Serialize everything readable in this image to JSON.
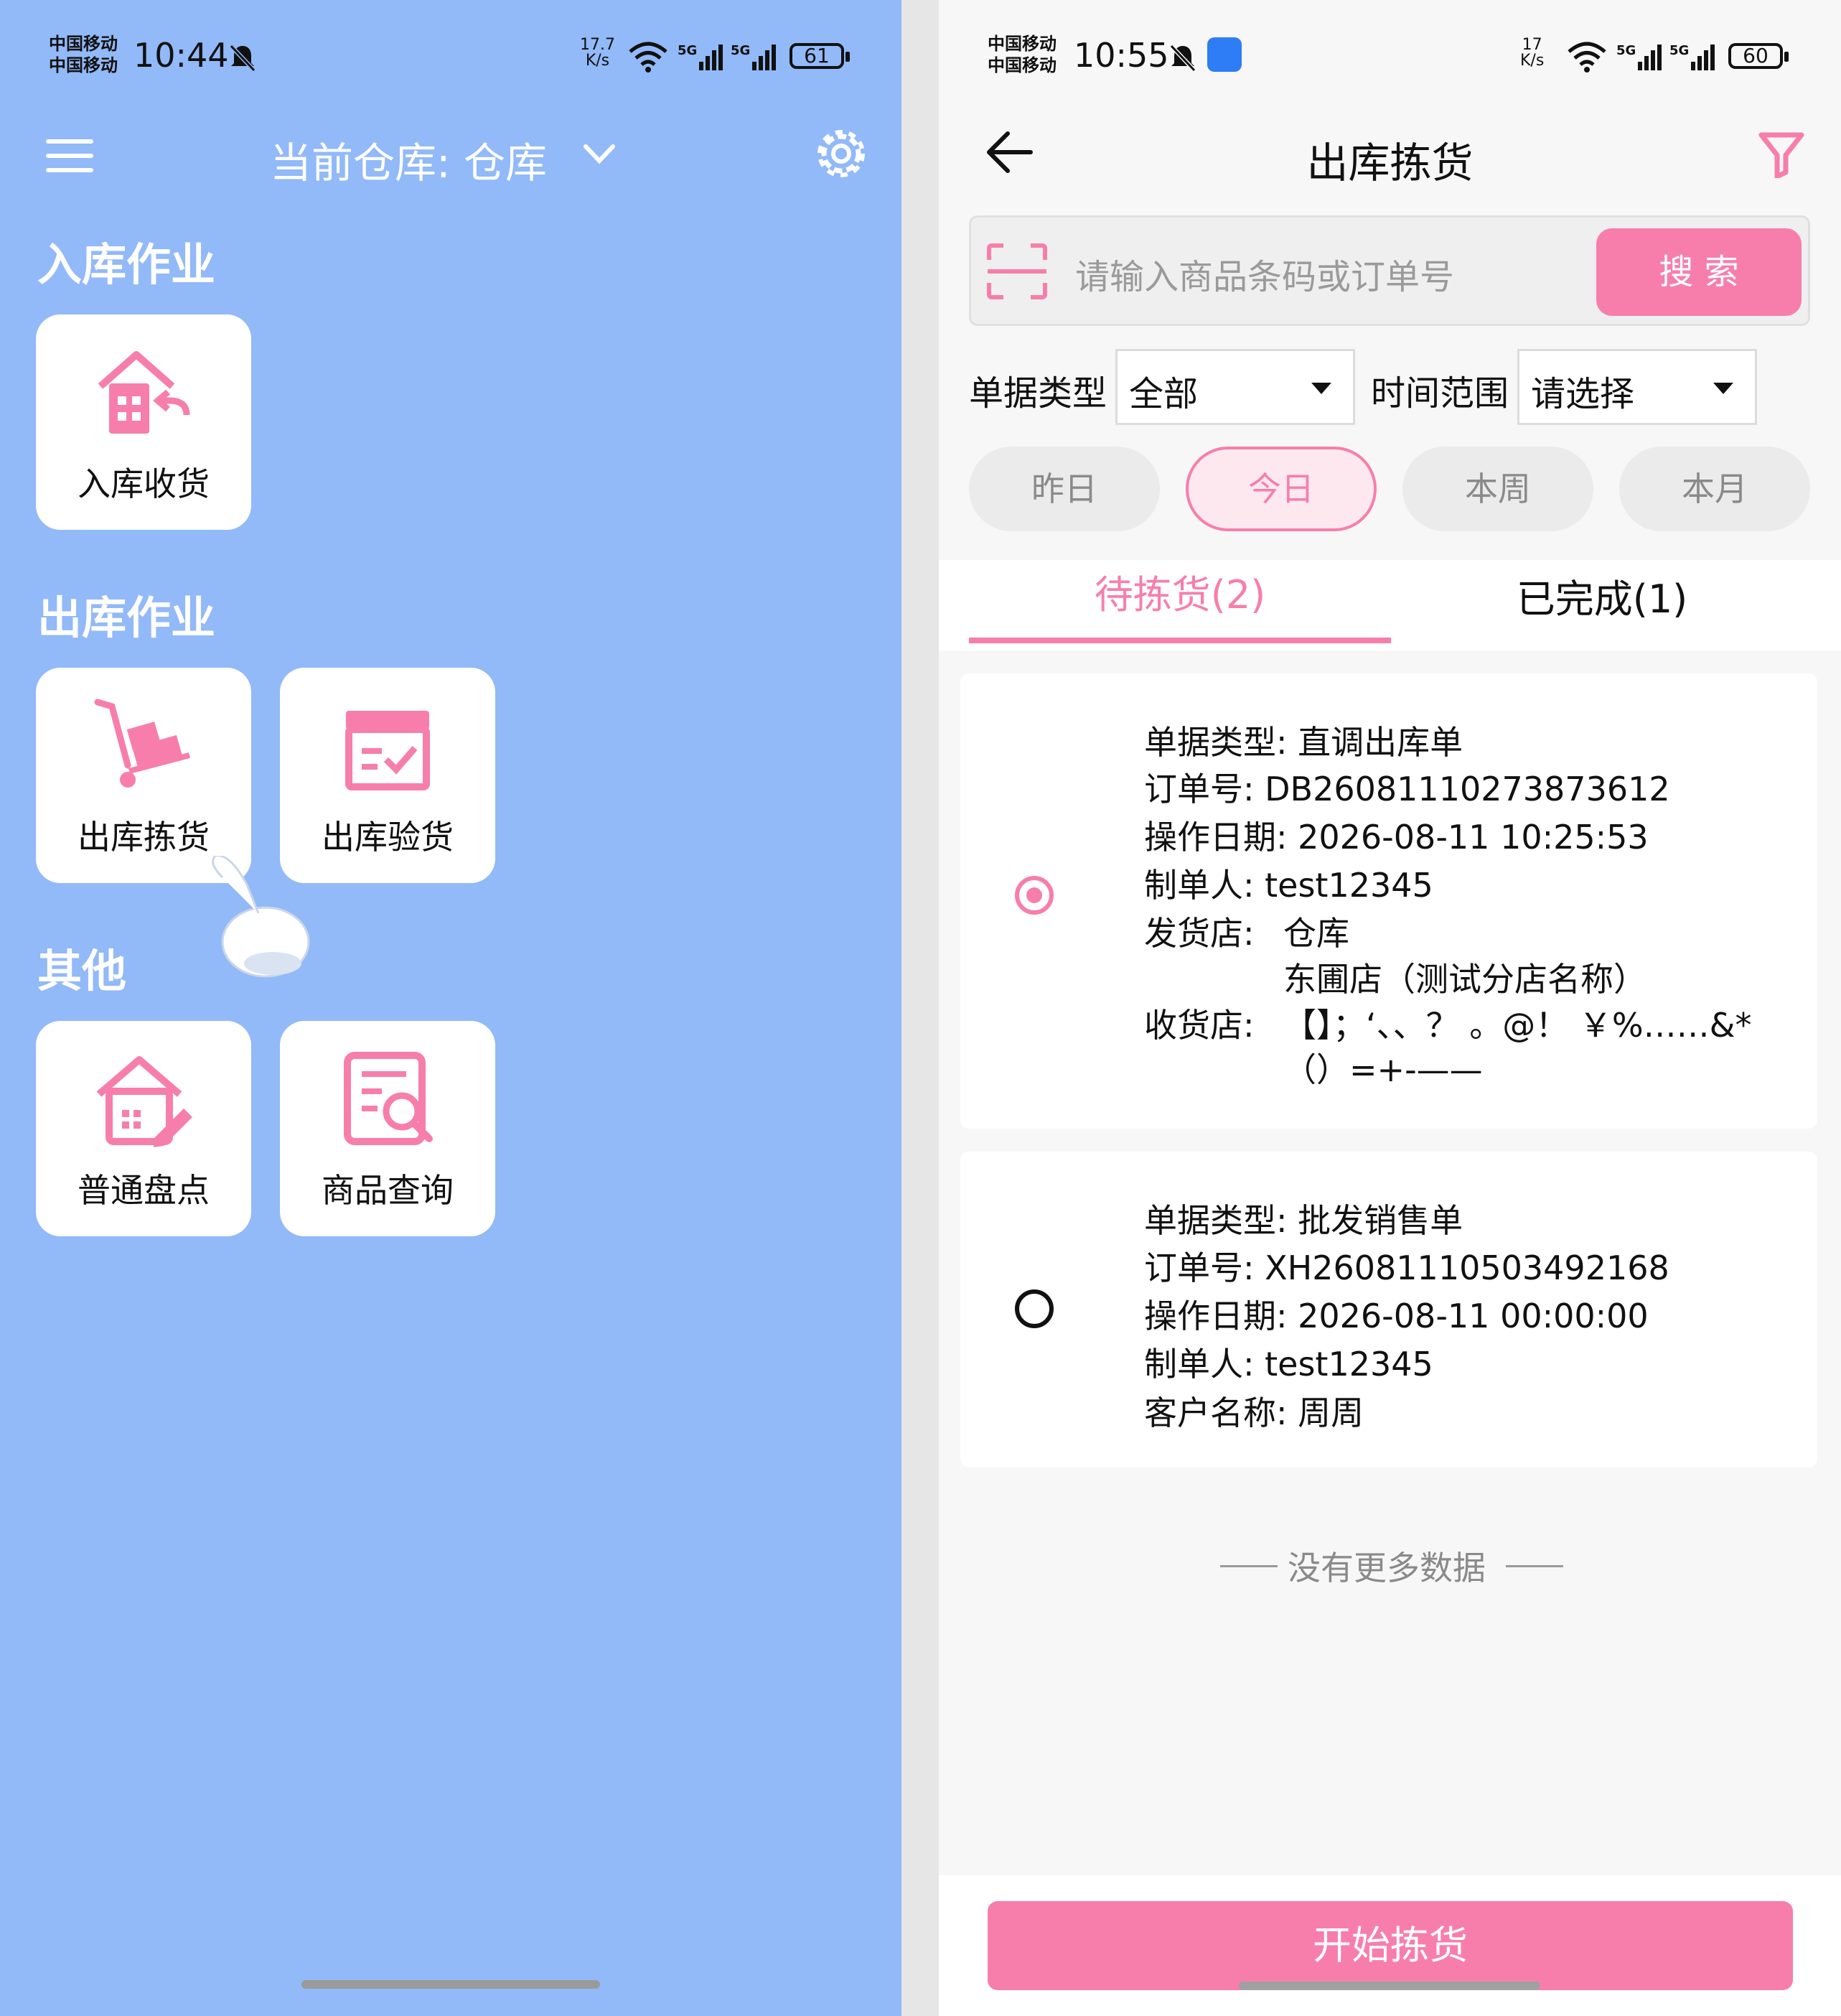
{
  "left": {
    "status": {
      "carrier1": "中国移动",
      "carrier2": "中国移动",
      "time": "10:44",
      "speed_top": "17.7",
      "speed_bottom": "K/s"
    },
    "header": {
      "warehouse_label": "当前仓库: 仓库"
    },
    "sections": {
      "inbound": "入库作业",
      "outbound": "出库作业",
      "other": "其他"
    },
    "tiles": {
      "receive": "入库收货",
      "pick": "出库拣货",
      "inspect": "出库验货",
      "inventory": "普通盘点",
      "query": "商品查询"
    }
  },
  "right": {
    "status": {
      "carrier1": "中国移动",
      "carrier2": "中国移动",
      "time": "10:55",
      "speed_top": "17",
      "speed_bottom": "K/s",
      "battery": "60"
    },
    "header": {
      "title": "出库拣货"
    },
    "search": {
      "placeholder": "请输入商品条码或订单号",
      "button": "搜 索"
    },
    "filters": {
      "type_label": "单据类型",
      "type_value": "全部",
      "time_label": "时间范围",
      "time_value": "请选择"
    },
    "chips": [
      "昨日",
      "今日",
      "本周",
      "本月"
    ],
    "tabs": [
      "待拣货(2)",
      "已完成(1)"
    ],
    "orders": [
      {
        "type": "单据类型: 直调出库单",
        "order_no": "订单号: DB26081110273873612",
        "date": "操作日期: 2026-08-11 10:25:53",
        "maker": "制单人: test12345",
        "from_label": "发货店:",
        "from_1": "仓库",
        "from_2": "东圃店（测试分店名称）",
        "to_label": "收货店:",
        "to_1": "【】；‘、、？ 。@！ ￥%……&*",
        "to_2": "（）=+-——"
      },
      {
        "type": "单据类型: 批发销售单",
        "order_no": "订单号: XH26081110503492168",
        "date": "操作日期: 2026-08-11 00:00:00",
        "maker": "制单人: test12345",
        "customer": "客户名称: 周周"
      }
    ],
    "no_more": "没有更多数据",
    "start_button": "开始拣货"
  },
  "left_battery": "61",
  "colors": {
    "accent": "#f77eab",
    "left_bg": "#92b9f8"
  }
}
